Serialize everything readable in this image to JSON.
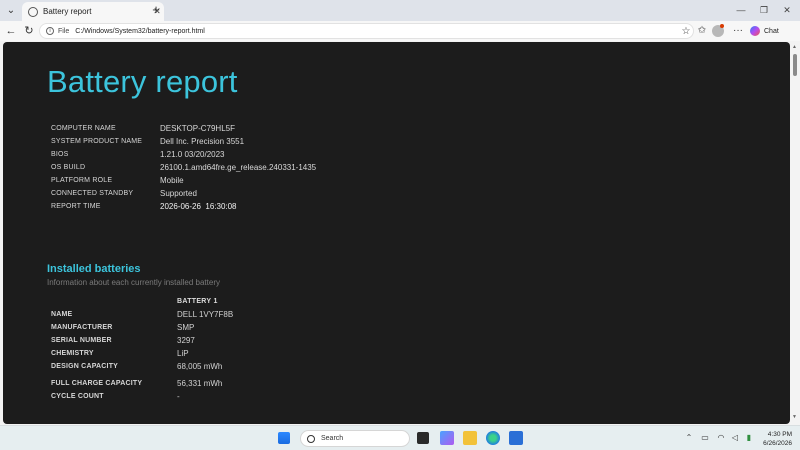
{
  "browser": {
    "tab_title": "Battery report",
    "url_scheme": "File",
    "url": "C:/Windows/System32/battery-report.html",
    "chat_label": "Chat"
  },
  "report": {
    "title": "Battery report",
    "system_info": [
      {
        "label": "COMPUTER NAME",
        "value": "DESKTOP-C79HL5F"
      },
      {
        "label": "SYSTEM PRODUCT NAME",
        "value": "Dell Inc. Precision 3551"
      },
      {
        "label": "BIOS",
        "value": "1.21.0 03/20/2023"
      },
      {
        "label": "OS BUILD",
        "value": "26100.1.amd64fre.ge_release.240331-1435"
      },
      {
        "label": "PLATFORM ROLE",
        "value": "Mobile"
      },
      {
        "label": "CONNECTED STANDBY",
        "value": "Supported"
      },
      {
        "label": "REPORT TIME",
        "value": "2026-06-26  16:30:08"
      }
    ],
    "installed": {
      "title": "Installed batteries",
      "subtitle": "Information about each currently installed battery",
      "column_header": "BATTERY 1",
      "rows": [
        {
          "label": "NAME",
          "value": "DELL 1VY7F8B"
        },
        {
          "label": "MANUFACTURER",
          "value": "SMP"
        },
        {
          "label": "SERIAL NUMBER",
          "value": "3297"
        },
        {
          "label": "CHEMISTRY",
          "value": "LiP"
        },
        {
          "label": "DESIGN CAPACITY",
          "value": "68,005 mWh"
        },
        {
          "label": "FULL CHARGE CAPACITY",
          "value": "56,331 mWh"
        },
        {
          "label": "CYCLE COUNT",
          "value": "-"
        }
      ]
    }
  },
  "taskbar": {
    "search_label": "Search",
    "time": "4:30 PM",
    "date": "6/26/2026"
  },
  "colors": {
    "accent": "#3cc4dc",
    "report_bg": "#1c1c1c"
  }
}
